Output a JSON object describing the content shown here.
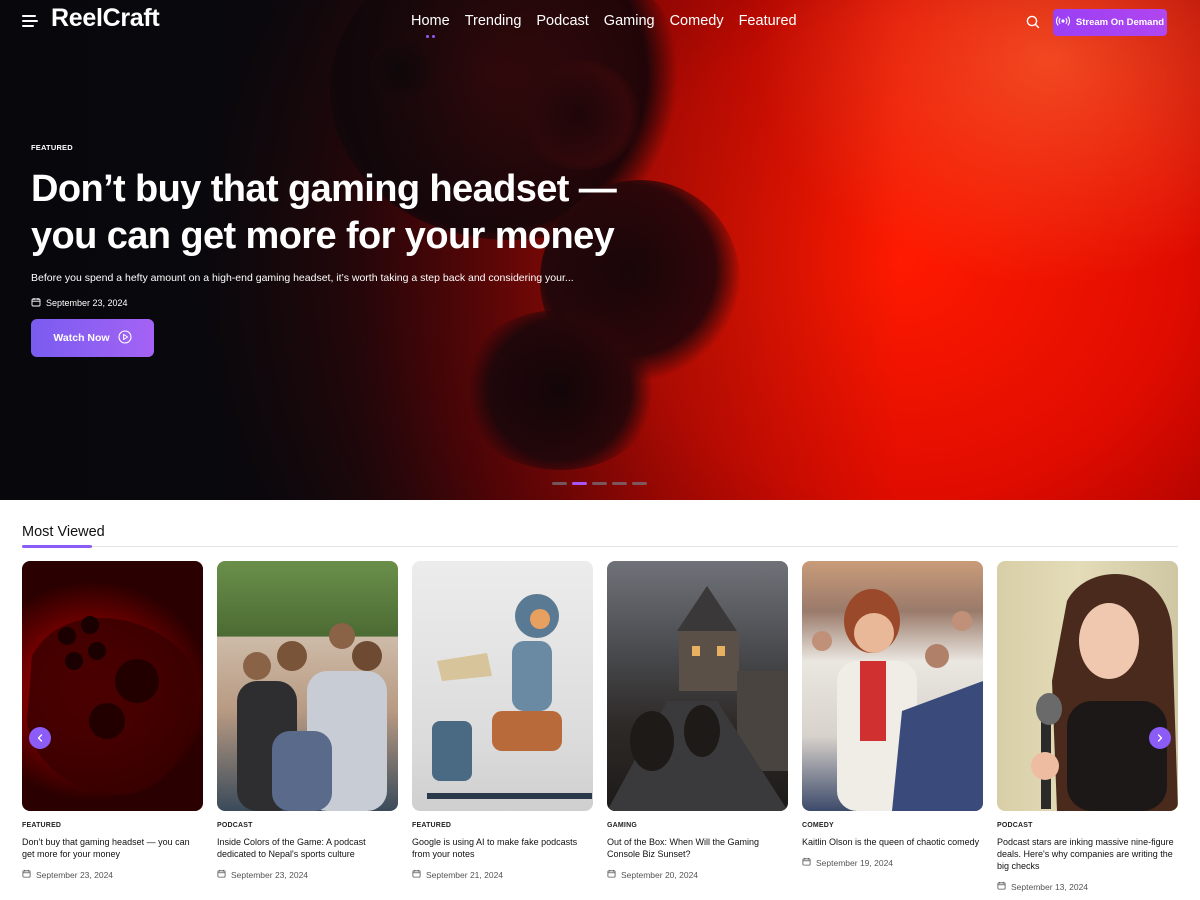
{
  "site": {
    "logo": "ReelCraft"
  },
  "nav": {
    "items": [
      "Home",
      "Trending",
      "Podcast",
      "Gaming",
      "Comedy",
      "Featured"
    ],
    "active": "Home"
  },
  "header": {
    "stream_button": "Stream On Demand"
  },
  "hero": {
    "category": "FEATURED",
    "title": "Don’t buy that gaming headset — you can get more for your money",
    "excerpt": "Before you spend a hefty amount on a high-end gaming headset, it’s worth taking a step back and considering your...",
    "date": "September 23, 2024",
    "watch_button": "Watch Now",
    "slides_total": 5,
    "active_slide": 2
  },
  "most_viewed": {
    "title": "Most Viewed",
    "cards": [
      {
        "category": "FEATURED",
        "title": "Don’t buy that gaming headset — you can get more for your money",
        "date": "September 23, 2024"
      },
      {
        "category": "PODCAST",
        "title": "Inside Colors of the Game: A podcast dedicated to Nepal's sports culture",
        "date": "September 23, 2024"
      },
      {
        "category": "FEATURED",
        "title": "Google is using AI to make fake podcasts from your notes",
        "date": "September 21, 2024"
      },
      {
        "category": "GAMING",
        "title": "Out of the Box: When Will the Gaming Console Biz Sunset?",
        "date": "September 20, 2024"
      },
      {
        "category": "COMEDY",
        "title": "Kaitlin Olson is the queen of chaotic comedy",
        "date": "September 19, 2024"
      },
      {
        "category": "PODCAST",
        "title": "Podcast stars are inking massive nine-figure deals. Here's why companies are writing the big checks",
        "date": "September 13, 2024"
      }
    ]
  },
  "colors": {
    "accent": "#8b5cf6",
    "stream_button": "#a142f2",
    "hero_red": "#ff1200"
  },
  "icons": [
    "menu-icon",
    "search-icon",
    "broadcast-icon",
    "play-circle-icon",
    "calendar-icon",
    "chevron-left-icon",
    "chevron-right-icon"
  ]
}
